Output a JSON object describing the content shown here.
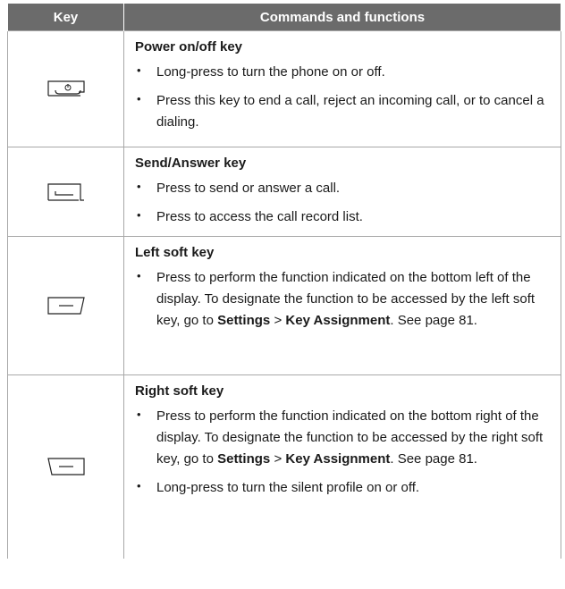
{
  "header": {
    "key": "Key",
    "commands": "Commands and functions"
  },
  "rows": [
    {
      "icon": "power-key-icon",
      "title": "Power on/off key",
      "bullets": [
        [
          "Long-press to turn the phone on or off."
        ],
        [
          "Press this key to end a call, reject an incoming call, or to cancel a dialing."
        ]
      ]
    },
    {
      "icon": "send-answer-key-icon",
      "title": "Send/Answer key",
      "bullets": [
        [
          "Press to send or answer a call."
        ],
        [
          "Press to access the call record list."
        ]
      ]
    },
    {
      "icon": "left-soft-key-icon",
      "title": "Left soft key",
      "bullets": [
        [
          "Press to perform the function indicated on the bottom left of the display. To designate the function to be accessed by the left soft key, go to ",
          "Settings",
          " > ",
          "Key Assignment",
          ". See page 81."
        ]
      ]
    },
    {
      "icon": "right-soft-key-icon",
      "title": "Right soft key",
      "bullets": [
        [
          "Press to perform the function indicated on the bottom right of the display. To designate the function to be accessed by the right soft key, go to ",
          "Settings",
          " > ",
          "Key Assignment",
          ". See page 81."
        ],
        [
          "Long-press to turn the silent profile on or off."
        ]
      ]
    }
  ]
}
